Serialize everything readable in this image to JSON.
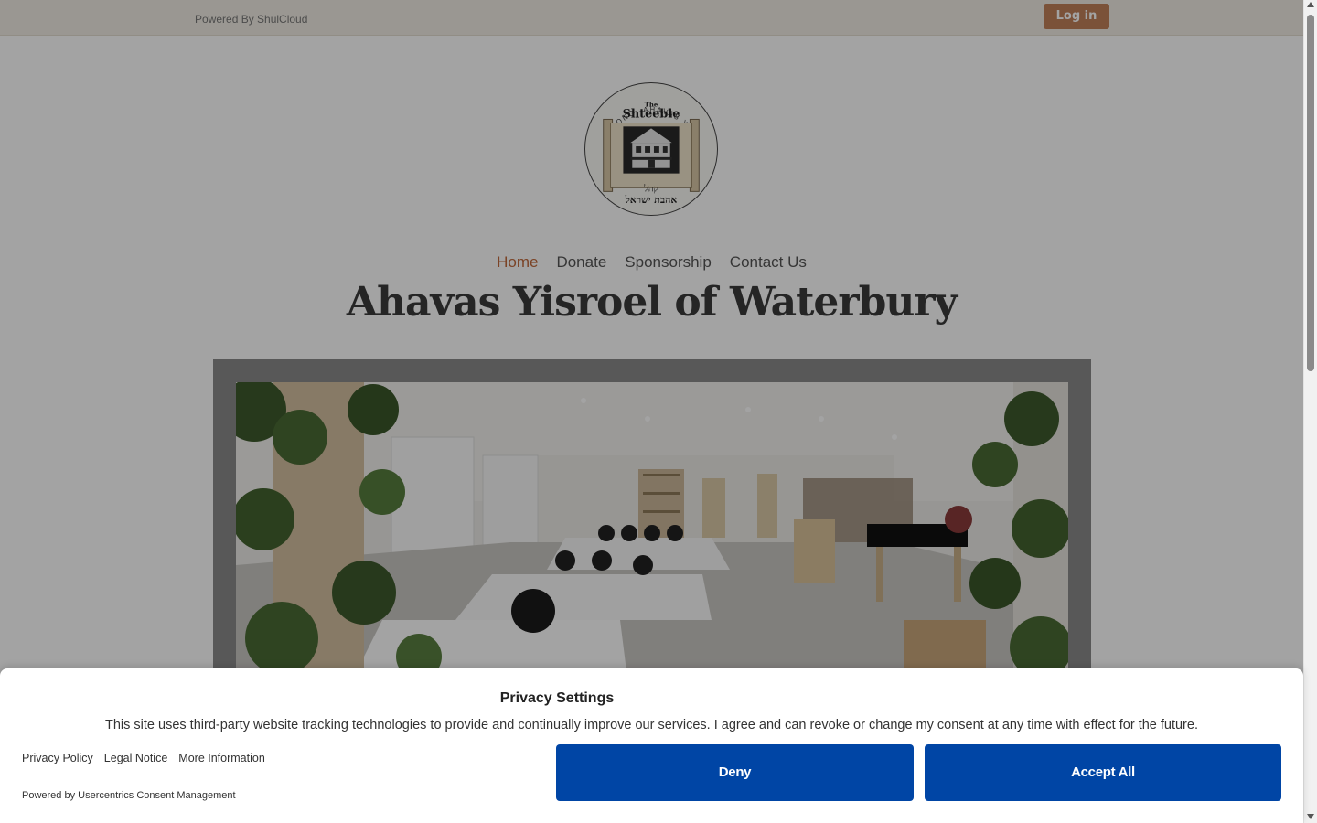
{
  "topbar": {
    "powered_by": "Powered By ShulCloud",
    "login_label": "Log in"
  },
  "logo": {
    "ring_text": "CONG. AHAVAS YISROEL",
    "title_small": "The",
    "title_big": "Shteeble",
    "hebrew_line1": "קהל",
    "hebrew_line2": "אהבת ישראל"
  },
  "nav": {
    "items": [
      {
        "label": "Home",
        "active": true
      },
      {
        "label": "Donate",
        "active": false
      },
      {
        "label": "Sponsorship",
        "active": false
      },
      {
        "label": "Contact Us",
        "active": false
      }
    ]
  },
  "site_title": "Ahavas Yisroel of Waterbury",
  "consent": {
    "title": "Privacy Settings",
    "description": "This site uses third-party website tracking technologies to provide and continually improve our services. I agree and can revoke or change my consent at any time with effect for the future.",
    "links": [
      "Privacy Policy",
      "Legal Notice",
      "More Information"
    ],
    "powered_by": "Powered by Usercentrics Consent Management",
    "deny_label": "Deny",
    "accept_label": "Accept All"
  },
  "colors": {
    "login_button": "#c0805a",
    "nav_active": "#c06a3c",
    "consent_button": "#0045a5"
  },
  "icons": [
    "scroll-up-arrow-icon",
    "scroll-down-arrow-icon"
  ]
}
